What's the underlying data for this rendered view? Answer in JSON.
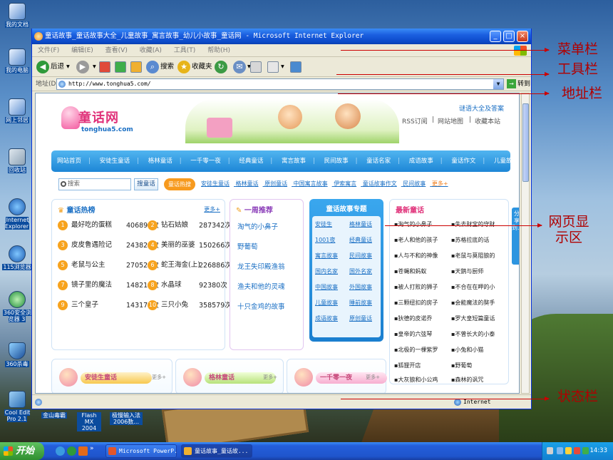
{
  "desktop": {
    "icons": [
      {
        "label": "我的文档",
        "name": "my-documents-icon"
      },
      {
        "label": "我的电脑",
        "name": "my-computer-icon"
      },
      {
        "label": "网上邻居",
        "name": "network-places-icon"
      },
      {
        "label": "回收站",
        "name": "recycle-bin-icon"
      },
      {
        "label": "Internet Explorer",
        "name": "ie-icon"
      },
      {
        "label": "115浏览器",
        "name": "browser-115-icon"
      },
      {
        "label": "360安全浏览器 3",
        "name": "browser-360-icon"
      },
      {
        "label": "360杀毒",
        "name": "antivirus-360-icon"
      },
      {
        "label": "Cool Edit Pro 2.1",
        "name": "cool-edit-icon"
      }
    ],
    "bottom_icons": [
      {
        "label": "金山毒霸",
        "name": "kingsoft-icon"
      },
      {
        "label": "Flash MX 2004",
        "name": "flash-icon"
      },
      {
        "label": "极慢输入法 2006数...",
        "name": "input-method-icon"
      }
    ]
  },
  "window": {
    "title": "童话故事_童话故事大全_儿童故事_寓言故事_幼儿小故事_童话网 - Microsoft Internet Explorer",
    "menu": [
      "文件(F)",
      "编辑(E)",
      "查看(V)",
      "收藏(A)",
      "工具(T)",
      "帮助(H)"
    ],
    "toolbar": {
      "back": "后退",
      "search": "搜索",
      "favorites": "收藏夹"
    },
    "address_label": "地址(D)",
    "address_value": "http://www.tonghua5.com/",
    "go_label": "转到",
    "status_zone": "Internet"
  },
  "page": {
    "logo_text": "童话网",
    "logo_url": "tonghua5.com",
    "top_links": {
      "riddle": "谜语大全及答案",
      "rss": "RSS订阅",
      "sitemap": "网站地图",
      "bookmark": "收藏本站"
    },
    "nav": [
      "网站首页",
      "安徒生童话",
      "格林童话",
      "一千零一夜",
      "经典童话",
      "寓言故事",
      "民间故事",
      "童话名家",
      "成语故事",
      "童话作文",
      "儿童故事"
    ],
    "search": {
      "placeholder": "搜索",
      "button": "搜童话",
      "hot": "童话热搜"
    },
    "keywords": [
      "安徒生童话",
      "格林童话",
      "原创童话",
      "中国寓言故事",
      "伊索寓言",
      "童话故事作文",
      "民间故事",
      "更多+"
    ],
    "hot": {
      "title": "童话热榜",
      "more": "更多+",
      "items": [
        {
          "n": "1",
          "title": "最好吃的蛋糕",
          "count": "406894次"
        },
        {
          "n": "2",
          "title": "钻石姑娘",
          "count": "287342次"
        },
        {
          "n": "3",
          "title": "皮皮鲁遇险记",
          "count": "243820次"
        },
        {
          "n": "4",
          "title": "美丽的巫婆",
          "count": "150266次"
        },
        {
          "n": "5",
          "title": "老鼠与公主",
          "count": "270528次"
        },
        {
          "n": "6",
          "title": "蛇王海金(上)",
          "count": "226886次"
        },
        {
          "n": "7",
          "title": "镜子里的魔法",
          "count": "148218次"
        },
        {
          "n": "8",
          "title": "水晶球",
          "count": "92380次"
        },
        {
          "n": "9",
          "title": "三个皇子",
          "count": "143170次"
        },
        {
          "n": "10",
          "title": "三只小兔",
          "count": "358579次"
        }
      ]
    },
    "weekly": {
      "title": "一周推荐",
      "items": [
        "淘气的小鼻子",
        "野葡萄",
        "龙王失印殿渔翁",
        "渔夫和他的灵魂",
        "十只金鸡的故事"
      ]
    },
    "topics": {
      "title": "童话故事专题",
      "items": [
        "安徒生",
        "格林童话",
        "1001夜",
        "经典童话",
        "寓言故事",
        "民间故事",
        "国内名家",
        "国外名家",
        "中国故事",
        "外国故事",
        "儿童故事",
        "睡前故事",
        "成语故事",
        "原创童话"
      ]
    },
    "latest": {
      "title": "最新童话",
      "items": [
        "淘气的小鼻子",
        "失去财宝的守财",
        "老人和他的孩子",
        "苏格拉底的话",
        "人与不和的神像",
        "老鼠与莫阻狼的",
        "苍蝇和蚂蚁",
        "天鹅与厨师",
        "被人打败的狮子",
        "不合在在呷的小",
        "三颗纽扣的房子",
        "会能魔法的獒手",
        "狄德的皮诺乔",
        "罗大皇短篇童话",
        "皇帝的六弦琴",
        "不曾长大的小泰",
        "北极的一棵紫罗",
        "小兔和小猫",
        "狐狸开店",
        "野葡萄",
        "大灰狼和小公鸡",
        "森林的讽咒"
      ]
    },
    "share_tab": "分享到...",
    "bottom_sections": [
      {
        "title": "安徒生童话",
        "more": "更多+"
      },
      {
        "title": "格林童话",
        "more": "更多+"
      },
      {
        "title": "一千零一夜",
        "more": "更多+"
      }
    ]
  },
  "annotations": {
    "menubar": "菜单栏",
    "toolbar": "工具栏",
    "addressbar": "地址栏",
    "viewarea": "网页显示区",
    "statusbar": "状态栏"
  },
  "taskbar": {
    "start": "开始",
    "tasks": [
      "Microsoft PowerP...",
      "童话故事_童话故..."
    ],
    "clock": "14:33"
  }
}
